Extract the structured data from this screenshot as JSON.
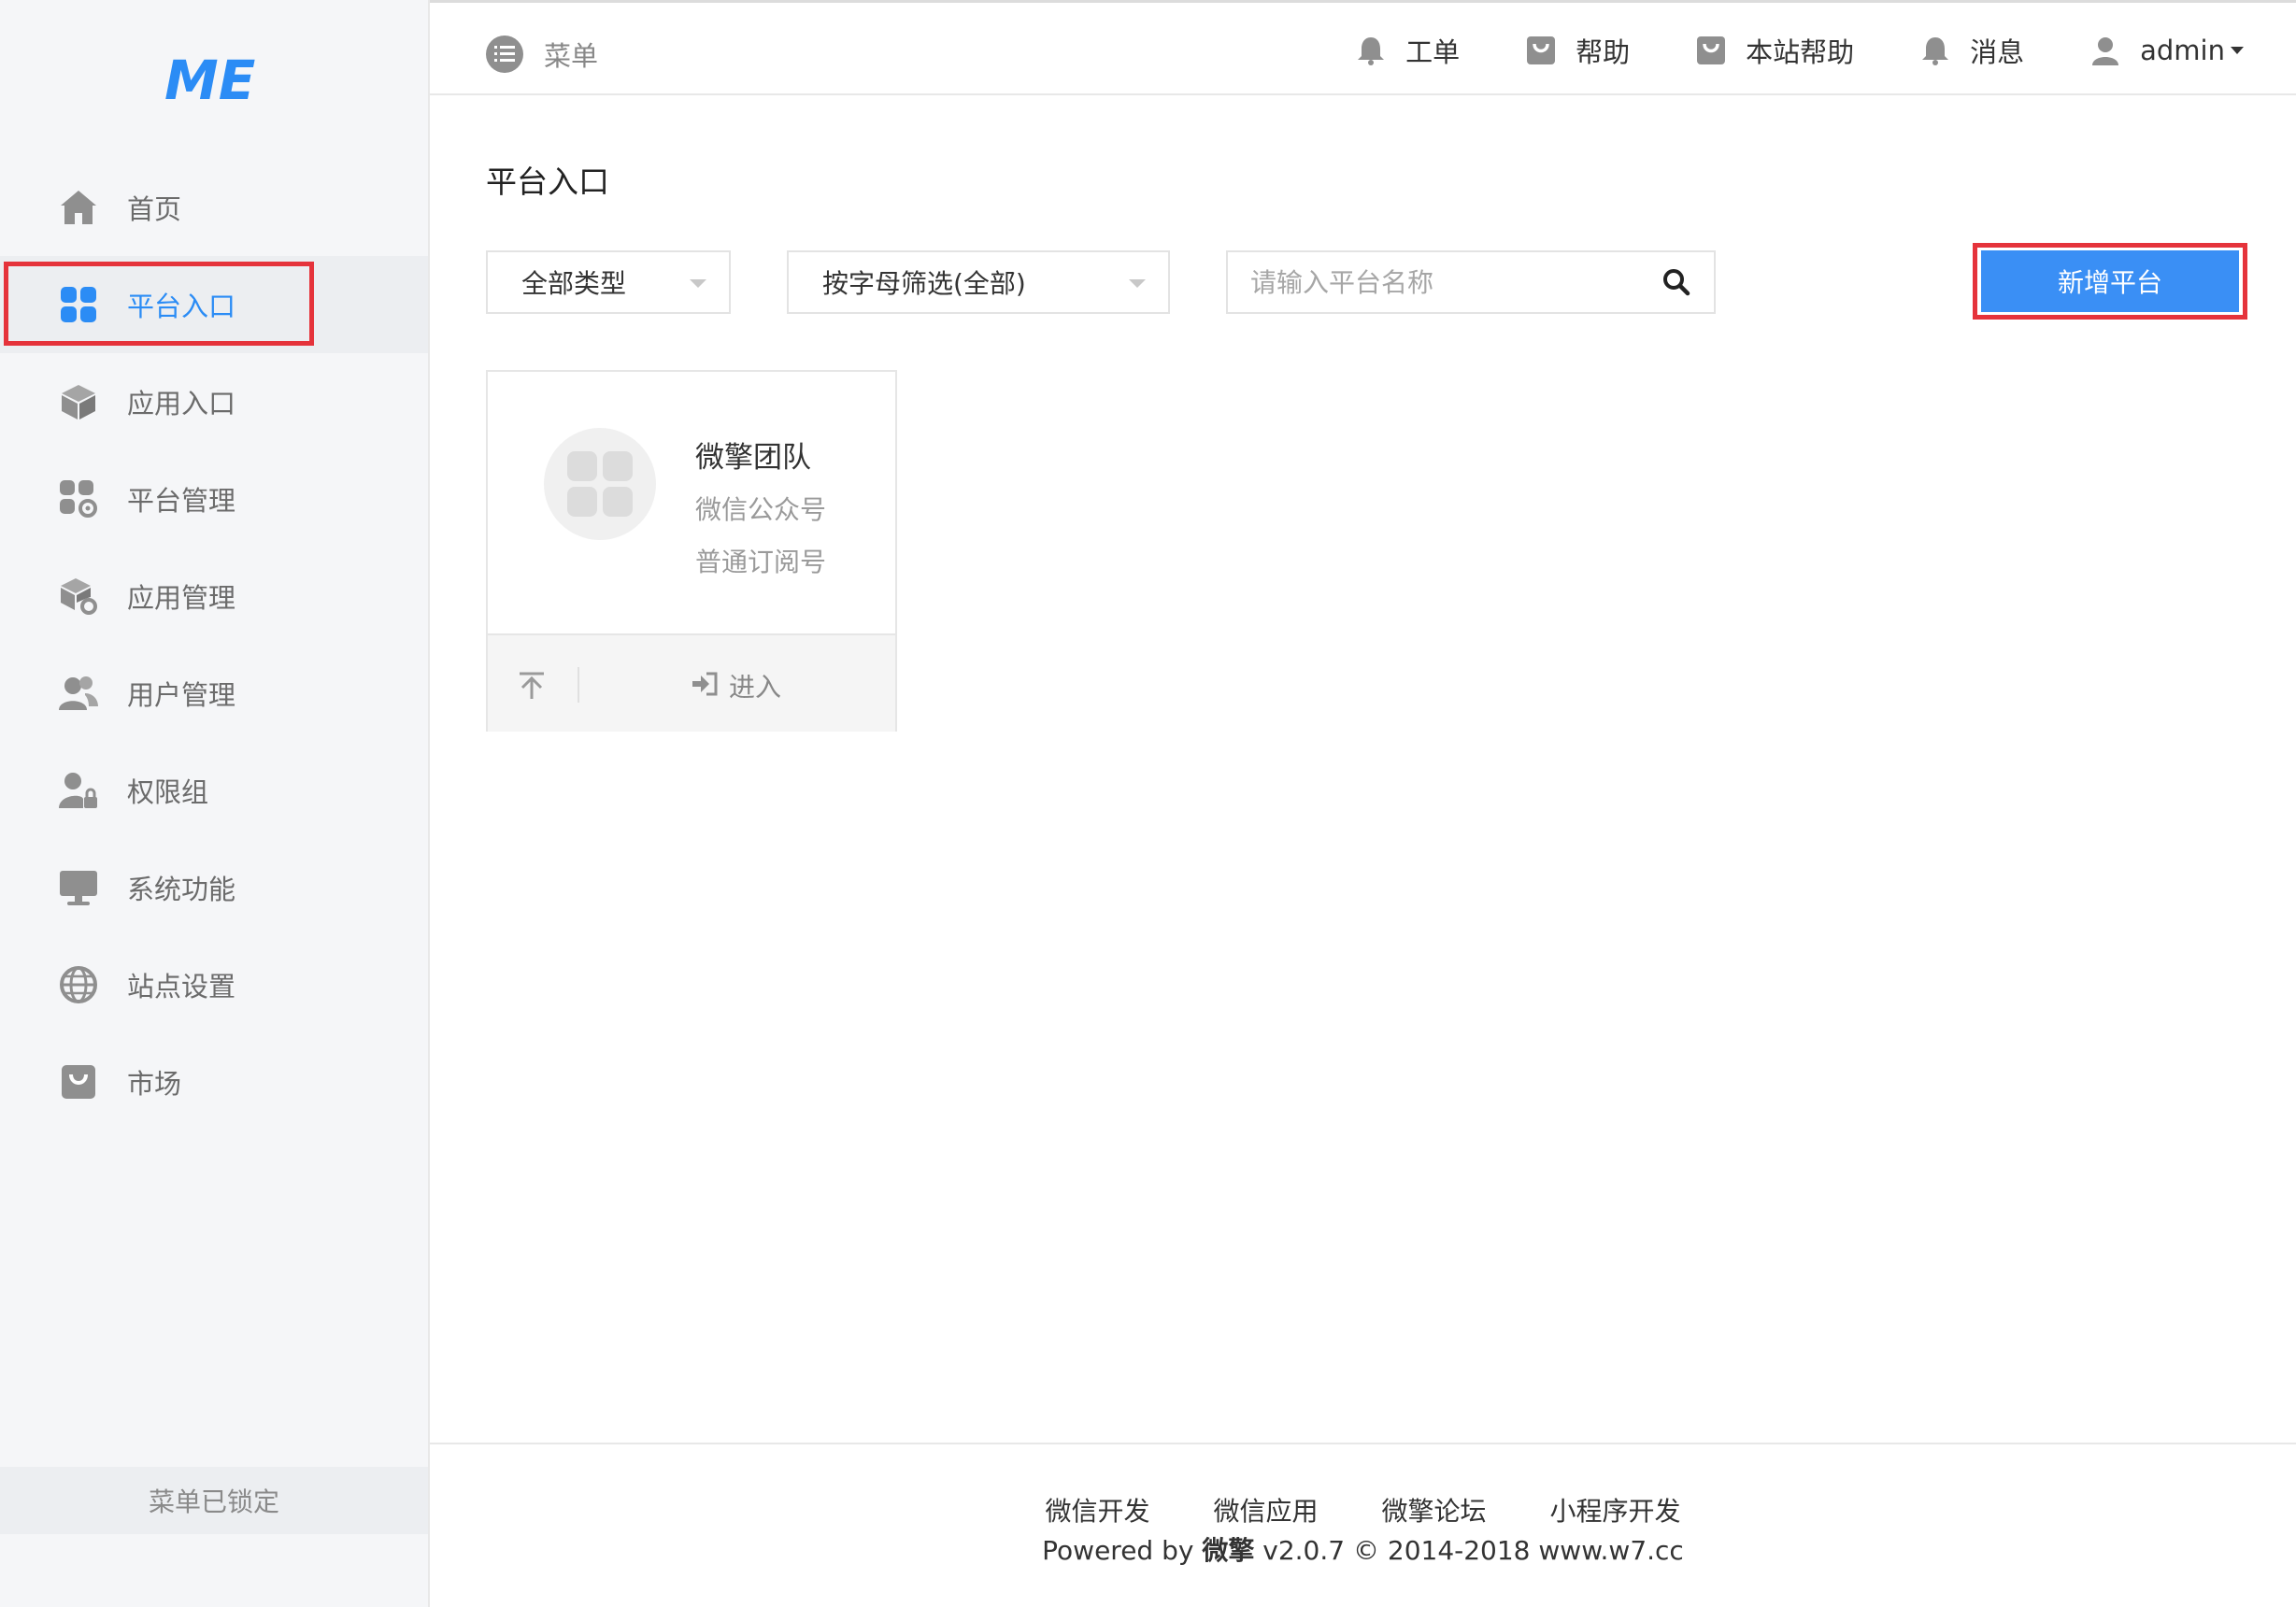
{
  "logo": {
    "text": "ME"
  },
  "sidebar": {
    "items": [
      {
        "label": "首页",
        "icon": "home-icon"
      },
      {
        "label": "平台入口",
        "icon": "grid-icon",
        "active": true
      },
      {
        "label": "应用入口",
        "icon": "cube-icon"
      },
      {
        "label": "平台管理",
        "icon": "grid-gear-icon"
      },
      {
        "label": "应用管理",
        "icon": "cube-gear-icon"
      },
      {
        "label": "用户管理",
        "icon": "users-icon"
      },
      {
        "label": "权限组",
        "icon": "user-lock-icon"
      },
      {
        "label": "系统功能",
        "icon": "monitor-icon"
      },
      {
        "label": "站点设置",
        "icon": "globe-icon"
      },
      {
        "label": "市场",
        "icon": "bag-icon"
      }
    ],
    "locked_label": "菜单已锁定"
  },
  "topbar": {
    "menu_label": "菜单",
    "links": [
      {
        "label": "工单",
        "icon": "bell-icon"
      },
      {
        "label": "帮助",
        "icon": "bag-icon"
      },
      {
        "label": "本站帮助",
        "icon": "bag-icon"
      },
      {
        "label": "消息",
        "icon": "bell-icon"
      }
    ],
    "user": "admin"
  },
  "main": {
    "title": "平台入口",
    "filter_type": "全部类型",
    "filter_letter": "按字母筛选(全部)",
    "search_placeholder": "请输入平台名称",
    "add_button": "新增平台"
  },
  "card": {
    "name": "微擎团队",
    "type": "微信公众号",
    "subtype": "普通订阅号",
    "enter_label": "进入"
  },
  "footer": {
    "links": [
      "微信开发",
      "微信应用",
      "微擎论坛",
      "小程序开发"
    ],
    "powered_prefix": "Powered by ",
    "brand": "微擎",
    "powered_suffix": " v2.0.7 © 2014-2018 www.w7.cc"
  },
  "colors": {
    "accent": "#3a8ff5",
    "highlight": "#e5333b",
    "sidebar_bg": "#f5f6f8"
  }
}
